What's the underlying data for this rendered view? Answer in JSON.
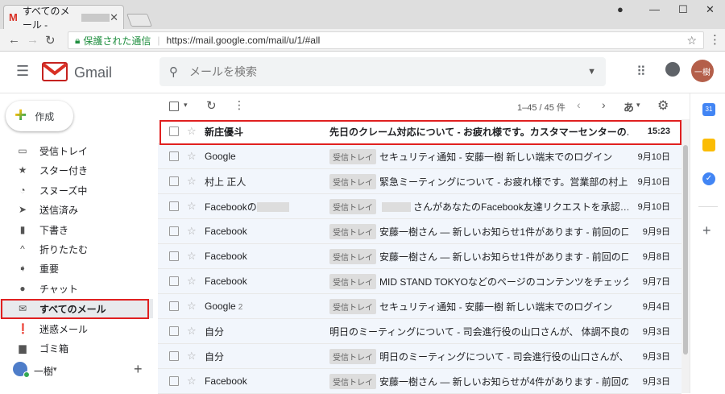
{
  "browser": {
    "tab_title": "すべてのメール - ",
    "tab_close": "✕",
    "secure_label": "保護された通信",
    "url": "https://mail.google.com/mail/u/1/#all"
  },
  "header": {
    "logo_text": "Gmail",
    "search_placeholder": "メールを検索",
    "avatar_text": "一樹"
  },
  "sidebar": {
    "compose_label": "作成",
    "items": [
      {
        "label": "受信トレイ",
        "icon": "inbox-icon",
        "glyph": "▭"
      },
      {
        "label": "スター付き",
        "icon": "star-icon",
        "glyph": "★"
      },
      {
        "label": "スヌーズ中",
        "icon": "clock-icon",
        "glyph": "◔"
      },
      {
        "label": "送信済み",
        "icon": "send-icon",
        "glyph": "➤"
      },
      {
        "label": "下書き",
        "icon": "draft-icon",
        "glyph": "▮"
      },
      {
        "label": "折りたたむ",
        "icon": "chevron-up-icon",
        "glyph": "^"
      },
      {
        "label": "重要",
        "icon": "important-icon",
        "glyph": "➧"
      },
      {
        "label": "チャット",
        "icon": "chat-icon",
        "glyph": "●"
      },
      {
        "label": "すべてのメール",
        "icon": "all-mail-icon",
        "glyph": "✉"
      },
      {
        "label": "迷惑メール",
        "icon": "spam-icon",
        "glyph": "❗"
      },
      {
        "label": "ゴミ箱",
        "icon": "trash-icon",
        "glyph": "▆"
      }
    ],
    "account_name": "一樹",
    "account_add": "+"
  },
  "toolbar": {
    "range": "1–45 / 45 件",
    "input_tool": "あ"
  },
  "messages": [
    {
      "sender": "新庄優斗",
      "label": "",
      "subject": "先日のクレーム対応について - お疲れ様です。カスタマーセンターの…",
      "date": "15:23",
      "unread": true
    },
    {
      "sender": "Google",
      "label": "受信トレイ",
      "subject": "セキュリティ通知 - 安藤一樹 新しい端末でのログイン",
      "date": "9月10日",
      "unread": false
    },
    {
      "sender": "村上 正人",
      "label": "受信トレイ",
      "subject": "緊急ミーティングについて - お疲れ様です。営業部の村上…",
      "date": "9月10日",
      "unread": false
    },
    {
      "sender": "Facebookの",
      "label": "受信トレイ",
      "subject": "さんがあなたのFacebook友達リクエストを承認…",
      "date": "9月10日",
      "unread": false
    },
    {
      "sender": "Facebook",
      "label": "受信トレイ",
      "subject": "安藤一樹さん — 新しいお知らせ1件があります - 前回の口…",
      "date": "9月9日",
      "unread": false
    },
    {
      "sender": "Facebook",
      "label": "受信トレイ",
      "subject": "安藤一樹さん — 新しいお知らせ1件があります - 前回の口…",
      "date": "9月8日",
      "unread": false
    },
    {
      "sender": "Facebook",
      "label": "受信トレイ",
      "subject": "MID STAND TOKYOなどのページのコンテンツをチェック…",
      "date": "9月7日",
      "unread": false
    },
    {
      "sender": "Google",
      "label": "受信トレイ",
      "subject": "セキュリティ通知 - 安藤一樹 新しい端末でのログイン",
      "date": "9月4日",
      "unread": false,
      "count": "2"
    },
    {
      "sender": "自分",
      "label": "",
      "subject": "明日のミーティングについて - 司会進行役の山口さんが、 体調不良の…",
      "date": "9月3日",
      "unread": false
    },
    {
      "sender": "自分",
      "label": "受信トレイ",
      "subject": "明日のミーティングについて - 司会進行役の山口さんが、…",
      "date": "9月3日",
      "unread": false
    },
    {
      "sender": "Facebook",
      "label": "受信トレイ",
      "subject": "安藤一樹さん — 新しいお知らせが4件があります - 前回の口…",
      "date": "9月3日",
      "unread": false
    }
  ]
}
